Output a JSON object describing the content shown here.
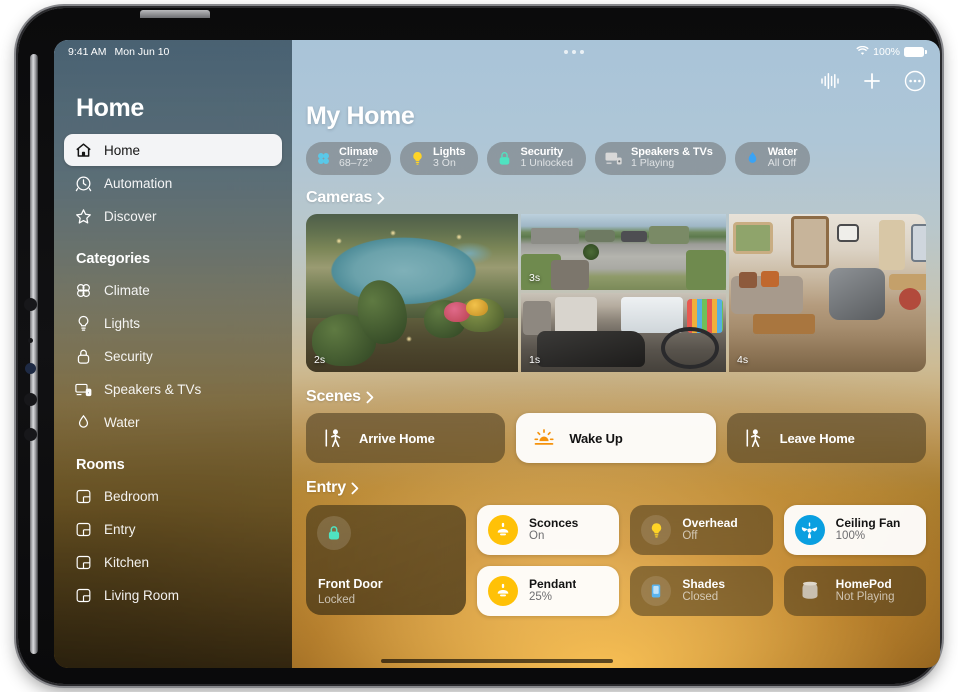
{
  "status_bar": {
    "time": "9:41 AM",
    "date": "Mon Jun 10",
    "battery_percent": "100%",
    "wifi_icon": "wifi-icon",
    "battery_icon": "battery-icon",
    "multitask_icon": "multitasking-dots-icon"
  },
  "toolbar": {
    "audio_label": "audio-waveform",
    "add_label": "add",
    "more_label": "more"
  },
  "sidebar": {
    "title": "Home",
    "primary": [
      {
        "label": "Home",
        "icon": "house-icon",
        "selected": true
      },
      {
        "label": "Automation",
        "icon": "clock-arrow-icon",
        "selected": false
      },
      {
        "label": "Discover",
        "icon": "star-icon",
        "selected": false
      }
    ],
    "categories_title": "Categories",
    "categories": [
      {
        "label": "Climate",
        "icon": "fan-icon"
      },
      {
        "label": "Lights",
        "icon": "lightbulb-icon"
      },
      {
        "label": "Security",
        "icon": "lock-icon"
      },
      {
        "label": "Speakers & TVs",
        "icon": "speaker-tv-icon"
      },
      {
        "label": "Water",
        "icon": "water-drop-icon"
      }
    ],
    "rooms_title": "Rooms",
    "rooms": [
      {
        "label": "Bedroom",
        "icon": "room-icon"
      },
      {
        "label": "Entry",
        "icon": "room-icon"
      },
      {
        "label": "Kitchen",
        "icon": "room-icon"
      },
      {
        "label": "Living Room",
        "icon": "room-icon"
      }
    ]
  },
  "main": {
    "title": "My Home",
    "status_pills": [
      {
        "name": "Climate",
        "value": "68–72°",
        "icon": "fan-icon",
        "color": "#5ac8e8"
      },
      {
        "name": "Lights",
        "value": "3 On",
        "icon": "lightbulb-icon",
        "color": "#ffd426"
      },
      {
        "name": "Security",
        "value": "1 Unlocked",
        "icon": "lock-icon",
        "color": "#4fe3c1"
      },
      {
        "name": "Speakers & TVs",
        "value": "1 Playing",
        "icon": "speaker-tv-icon",
        "color": "#d8d8d8"
      },
      {
        "name": "Water",
        "value": "All Off",
        "icon": "water-drop-icon",
        "color": "#3aa3f5"
      }
    ],
    "cameras": {
      "header": "Cameras",
      "tiles": [
        {
          "name": "Backyard Pool",
          "timestamp": "2s"
        },
        {
          "name": "Driveway",
          "timestamp": "3s"
        },
        {
          "name": "Garage",
          "timestamp": "1s"
        },
        {
          "name": "Living Room",
          "timestamp": "4s"
        }
      ]
    },
    "scenes": {
      "header": "Scenes",
      "items": [
        {
          "label": "Arrive Home",
          "icon": "person-enter-icon",
          "active": false
        },
        {
          "label": "Wake Up",
          "icon": "sunrise-icon",
          "active": true
        },
        {
          "label": "Leave Home",
          "icon": "person-exit-icon",
          "active": false
        }
      ]
    },
    "entry": {
      "header": "Entry",
      "front_door": {
        "name": "Front Door",
        "state": "Locked",
        "icon": "lock-icon",
        "color": "#4fe3c1"
      },
      "accessories": [
        {
          "name": "Sconces",
          "state": "On",
          "icon": "sconce-icon",
          "color": "#ffc107",
          "active": true
        },
        {
          "name": "Overhead",
          "state": "Off",
          "icon": "lightbulb-icon",
          "color": "#ffd426",
          "active": false
        },
        {
          "name": "Ceiling Fan",
          "state": "100%",
          "icon": "ceiling-fan-icon",
          "color": "#0a9fe0",
          "active": true
        },
        {
          "name": "Pendant",
          "state": "25%",
          "icon": "sconce-icon",
          "color": "#ffc107",
          "active": true
        },
        {
          "name": "Shades",
          "state": "Closed",
          "icon": "shade-icon",
          "color": "#5ab4f0",
          "active": false
        },
        {
          "name": "HomePod",
          "state": "Not Playing",
          "icon": "homepod-icon",
          "color": "#c8bfb0",
          "active": false
        }
      ]
    }
  }
}
